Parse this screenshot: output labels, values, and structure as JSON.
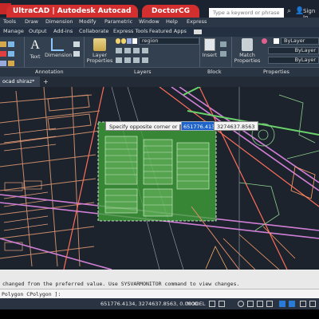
{
  "titlebar": {
    "banner_left": "UltraCAD | Autodesk Autocad Tutorials",
    "banner_right": "DoctorCG",
    "search_placeholder": "Type a keyword or phrase",
    "sign_in": "Sign In"
  },
  "menubar": {
    "items": [
      "Tools",
      "Draw",
      "Dimension",
      "Modify",
      "Parametric",
      "Window",
      "Help",
      "Express"
    ]
  },
  "ribbon_tabs": {
    "items": [
      "Manage",
      "Output",
      "Add-ins",
      "Collaborate",
      "Express Tools",
      "Featured Apps"
    ]
  },
  "ribbon": {
    "text_label": "Text",
    "dimension_label": "Dimension",
    "layer_properties_label": "Layer Properties",
    "layer_name": "region",
    "insert_label": "Insert",
    "match_properties_label": "Match Properties",
    "bylayer_color": "ByLayer",
    "bylayer_linetype": "ByLayer",
    "bylayer_lineweight": "ByLayer",
    "annotation_panel": "Annotation",
    "layers_panel": "Layers",
    "block_panel": "Block",
    "properties_panel": "Properties"
  },
  "document": {
    "tab_label": "ocad shiraz*",
    "add_tab": "+"
  },
  "prompt": {
    "tooltip": "Specify opposite corner or",
    "coord_x": "651776.4134",
    "coord_y": "3274637.8563"
  },
  "command": {
    "history_line": "changed from the preferred value. Use SYSVARMONITOR command to view changes.",
    "current_line": "Polygon CPolygon ]:",
    "options": "Polygon CPolygon"
  },
  "status": {
    "coordinates": "651776.4134, 3274637.8563, 0.0000",
    "space": "MODEL"
  },
  "colors": {
    "selection_fill": "#3fa33a",
    "accent_red": "#d32f2f",
    "canvas_bg": "#1c232c"
  }
}
